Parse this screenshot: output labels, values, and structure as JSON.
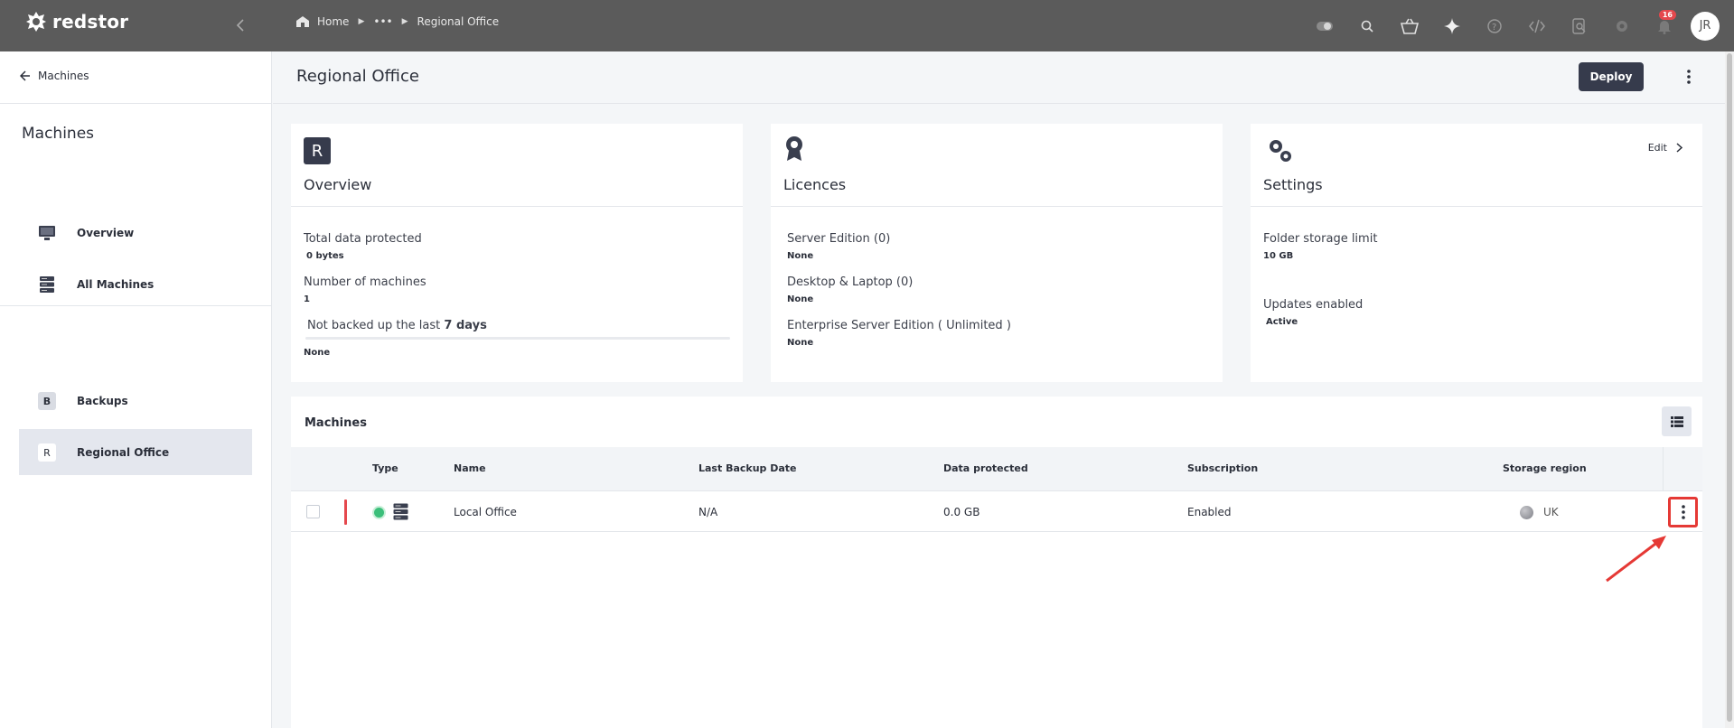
{
  "topbar": {
    "logo_text": "redstor",
    "breadcrumb": {
      "home": "Home",
      "ellipsis": "•••",
      "current": "Regional Office"
    },
    "icons": [
      "toggle-icon",
      "search-icon",
      "basket-icon",
      "sparkle-icon",
      "help-icon",
      "code-icon",
      "search-doc-icon",
      "gear-icon",
      "bell-icon"
    ],
    "notification_count": "16",
    "avatar_initials": "JR"
  },
  "sidebar": {
    "back_label": "Machines",
    "title": "Machines",
    "items": [
      {
        "label": "Overview",
        "icon": "monitor-icon"
      },
      {
        "label": "All Machines",
        "icon": "server-icon"
      },
      {
        "label": "Backups",
        "letter": "B"
      },
      {
        "label": "Regional Office",
        "letter": "R",
        "active": true
      }
    ]
  },
  "header": {
    "title": "Regional Office",
    "deploy_label": "Deploy"
  },
  "cards": {
    "overview": {
      "letter": "R",
      "title": "Overview",
      "fields": [
        {
          "label": "Total data protected",
          "value": "0 bytes"
        },
        {
          "label": "Number of machines",
          "value": "1"
        }
      ],
      "not_backed_prefix": "Not backed up the last",
      "not_backed_days": "7 days",
      "not_backed_value": "None"
    },
    "licences": {
      "title": "Licences",
      "fields": [
        {
          "label": "Server Edition (0)",
          "value": "None"
        },
        {
          "label": "Desktop & Laptop (0)",
          "value": "None"
        },
        {
          "label": "Enterprise Server Edition ( Unlimited )",
          "value": "None"
        }
      ]
    },
    "settings": {
      "title": "Settings",
      "edit_label": "Edit",
      "fields": [
        {
          "label": "Folder storage limit",
          "value": "10 GB"
        },
        {
          "label": "Updates enabled",
          "value": "Active"
        }
      ]
    }
  },
  "machines": {
    "title": "Machines",
    "columns": [
      "Type",
      "Name",
      "Last Backup Date",
      "Data protected",
      "Subscription",
      "Storage region"
    ],
    "rows": [
      {
        "name": "Local Office",
        "last_backup": "N/A",
        "data_protected": "0.0 GB",
        "subscription": "Enabled",
        "region": "UK"
      }
    ]
  },
  "colors": {
    "topbar": "#5b5b5b",
    "accent_dark": "#363b4c",
    "status_ok": "#3bbf7a",
    "highlight": "#e53935"
  }
}
